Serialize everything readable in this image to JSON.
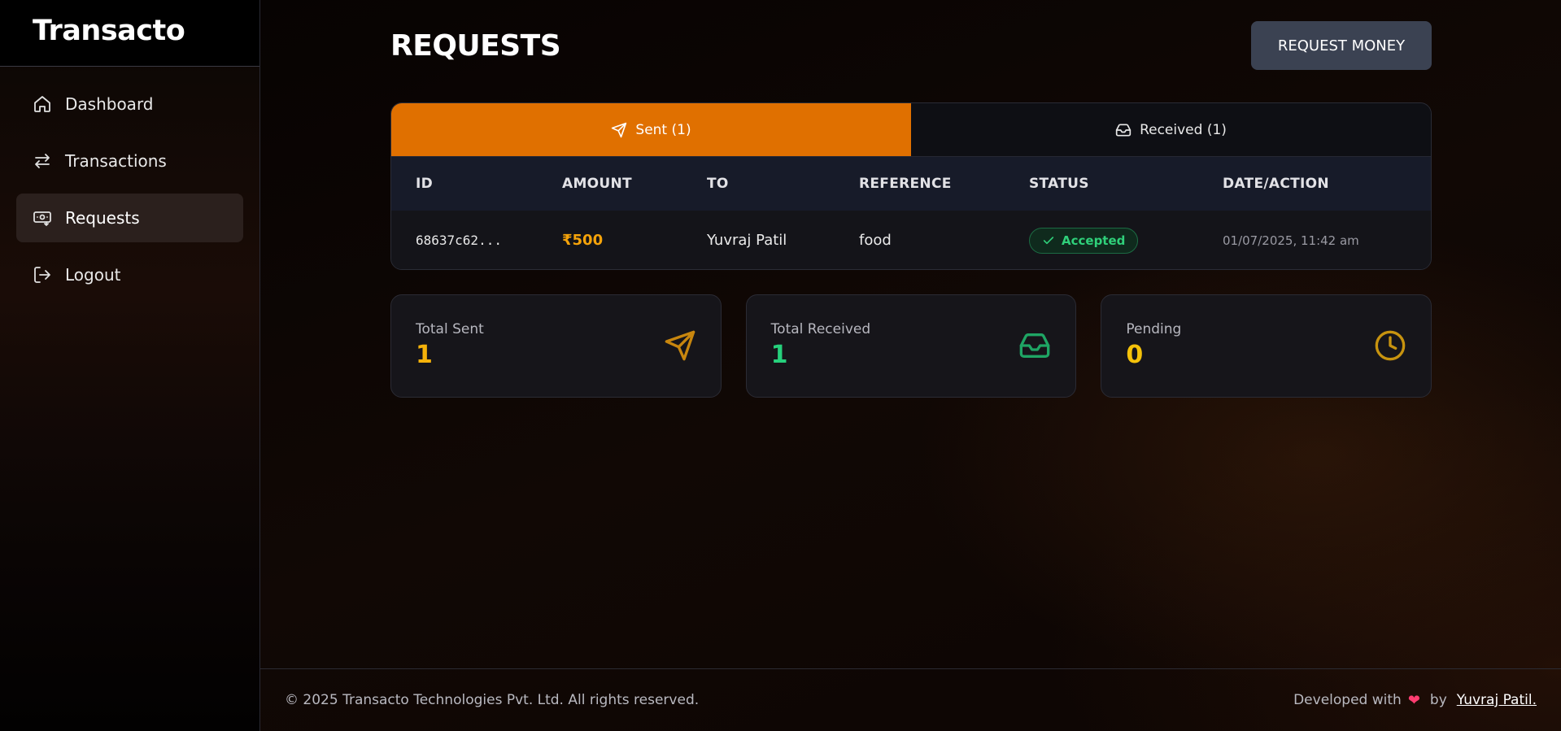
{
  "brand": "Transacto",
  "sidebar": {
    "items": [
      {
        "label": "Dashboard",
        "icon": "home-icon"
      },
      {
        "label": "Transactions",
        "icon": "arrows-icon"
      },
      {
        "label": "Requests",
        "icon": "money-request-icon",
        "active": true
      },
      {
        "label": "Logout",
        "icon": "logout-icon"
      }
    ]
  },
  "page": {
    "title": "REQUESTS",
    "request_button": "REQUEST MONEY"
  },
  "tabs": [
    {
      "label": "Sent (1)",
      "icon": "send-icon",
      "active": true
    },
    {
      "label": "Received (1)",
      "icon": "inbox-icon",
      "active": false
    }
  ],
  "table": {
    "headers": [
      "ID",
      "AMOUNT",
      "TO",
      "REFERENCE",
      "STATUS",
      "DATE/ACTION"
    ],
    "rows": [
      {
        "id": "68637c62...",
        "amount": "₹500",
        "to": "Yuvraj Patil",
        "reference": "food",
        "status": "Accepted",
        "date": "01/07/2025, 11:42 am"
      }
    ]
  },
  "stats": [
    {
      "label": "Total Sent",
      "value": "1",
      "color": "#f5b20a",
      "icon": "send-icon",
      "icon_color": "#c8860e"
    },
    {
      "label": "Total Received",
      "value": "1",
      "color": "#26d07c",
      "icon": "inbox-icon",
      "icon_color": "#1fa564"
    },
    {
      "label": "Pending",
      "value": "0",
      "color": "#f5c20a",
      "icon": "clock-icon",
      "icon_color": "#c7930f"
    }
  ],
  "footer": {
    "copyright": "© 2025 Transacto Technologies Pvt. Ltd. All rights reserved.",
    "developed_with": "Developed with",
    "heart": "❤",
    "by": "by",
    "developer": "Yuvraj Patil."
  },
  "colors": {
    "accent": "#e07000",
    "status_accepted": "#2fd07a",
    "amount": "#f5a30a"
  }
}
